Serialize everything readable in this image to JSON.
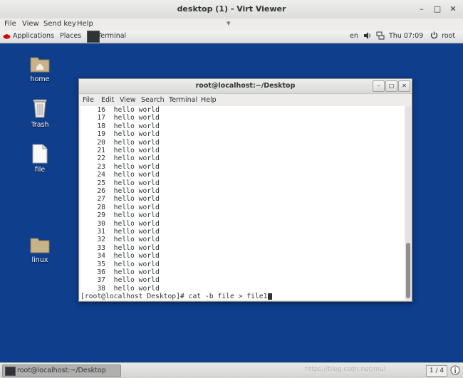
{
  "viewer": {
    "title": "desktop (1) - Virt Viewer",
    "menu": [
      "File",
      "View",
      "Send key",
      "Help"
    ],
    "controls": {
      "minimize": "–",
      "maximize": "□",
      "close": "✕"
    }
  },
  "panel": {
    "applications": "Applications",
    "places": "Places",
    "terminal": "Terminal",
    "lang": "en",
    "clock": "Thu 07:09",
    "user": "root"
  },
  "desktop": {
    "icons": [
      {
        "label": "home",
        "icon": "home-folder-icon"
      },
      {
        "label": "Trash",
        "icon": "trash-icon"
      },
      {
        "label": "file",
        "icon": "file-icon"
      },
      {
        "label": "linux",
        "icon": "folder-icon"
      }
    ],
    "background": "#0e3e8c"
  },
  "terminal": {
    "title": "root@localhost:~/Desktop",
    "menu": [
      "File",
      "Edit",
      "View",
      "Search",
      "Terminal",
      "Help"
    ],
    "controls": {
      "minimize": "–",
      "maximize": "□",
      "close": "✕"
    },
    "lines": [
      "    16  hello world",
      "    17  hello world",
      "    18  hello world",
      "    19  hello world",
      "    20  hello world",
      "    21  hello world",
      "    22  hello world",
      "    23  hello world",
      "    24  hello world",
      "    25  hello world",
      "    26  hello world",
      "    27  hello world",
      "    28  hello world",
      "    29  hello world",
      "    30  hello world",
      "    31  hello world",
      "    32  hello world",
      "    33  hello world",
      "    34  hello world",
      "    35  hello world",
      "    36  hello world",
      "    37  hello world",
      "    38  hello world"
    ],
    "prompt": "[root@localhost Desktop]# cat -b file > file1"
  },
  "taskbar": {
    "task_label": "root@localhost:~/Desktop",
    "watermark": "https://blog.csdn.net/mul",
    "workspace": "1 / 4"
  }
}
